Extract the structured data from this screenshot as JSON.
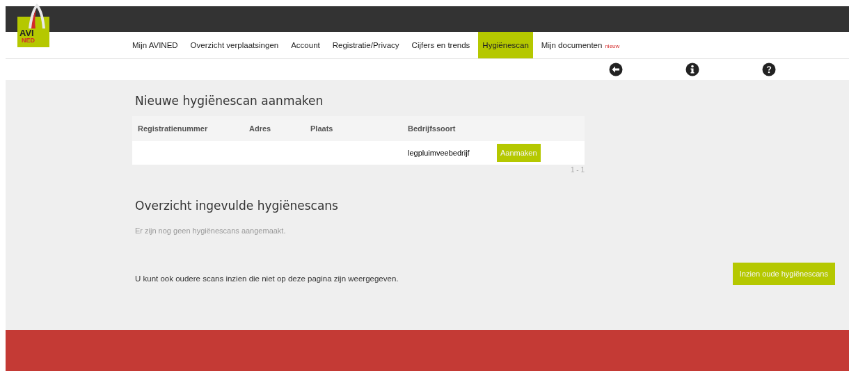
{
  "logo": {
    "text": "AVI",
    "subtext": "NED"
  },
  "nav": [
    {
      "label": "Mijn AVINED",
      "selected": false
    },
    {
      "label": "Overzicht verplaatsingen",
      "selected": false
    },
    {
      "label": "Account",
      "selected": false
    },
    {
      "label": "Registratie/Privacy",
      "selected": false
    },
    {
      "label": "Cijfers en trends",
      "selected": false
    },
    {
      "label": "Hygiënescan",
      "selected": true
    },
    {
      "label": "Mijn documenten",
      "selected": false,
      "badge": "nieuw"
    }
  ],
  "toolbar": [
    {
      "kind": "back"
    },
    {
      "kind": "info"
    },
    {
      "kind": "help"
    }
  ],
  "new_scan": {
    "title": "Nieuwe hygiënescan aanmaken",
    "columns": [
      "Registratienummer",
      "Adres",
      "Plaats",
      "Bedrijfssoort"
    ],
    "rows": [
      {
        "cells": [
          "",
          "",
          "",
          "legpluimveebedrijf"
        ],
        "action": "Aanmaken"
      }
    ],
    "pagination": "1 - 1"
  },
  "overview": {
    "title": "Overzicht ingevulde hygiënescans",
    "empty": "Er zijn nog geen hygiënescans aangemaakt.",
    "note": "U kunt ook oudere scans inzien die niet op deze pagina zijn weergegeven.",
    "button": "Inzien oude hygiënescans"
  }
}
